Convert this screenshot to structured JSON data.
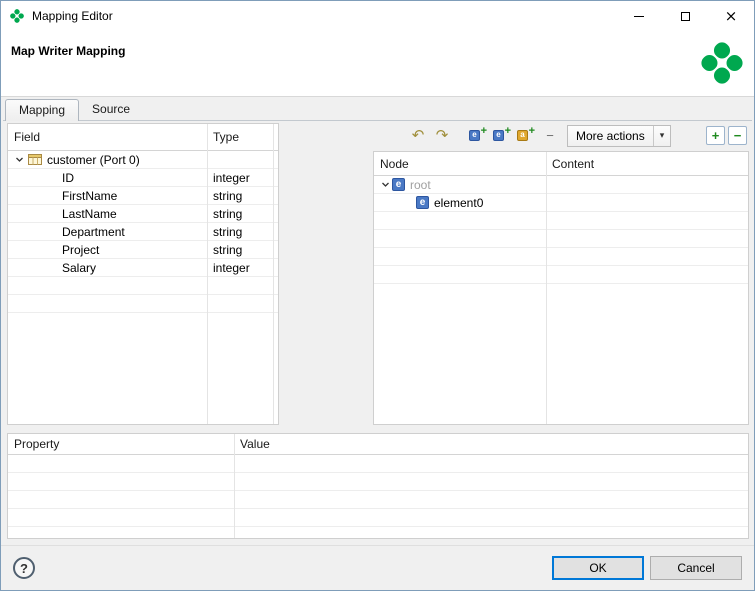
{
  "window": {
    "title": "Mapping Editor"
  },
  "header": {
    "title": "Map Writer Mapping"
  },
  "tabs": {
    "mapping": "Mapping",
    "source": "Source"
  },
  "field_table": {
    "col_field": "Field",
    "col_type": "Type",
    "root_label": "customer (Port 0)",
    "rows": [
      {
        "field": "ID",
        "type": "integer"
      },
      {
        "field": "FirstName",
        "type": "string"
      },
      {
        "field": "LastName",
        "type": "string"
      },
      {
        "field": "Department",
        "type": "string"
      },
      {
        "field": "Project",
        "type": "string"
      },
      {
        "field": "Salary",
        "type": "integer"
      }
    ]
  },
  "toolbar": {
    "more_actions": "More actions"
  },
  "node_table": {
    "col_node": "Node",
    "col_content": "Content",
    "root_label": "root",
    "child_label": "element0"
  },
  "property_table": {
    "col_property": "Property",
    "col_value": "Value"
  },
  "footer": {
    "ok": "OK",
    "cancel": "Cancel"
  },
  "icons": {
    "help": "?",
    "undo_arrow": "↶",
    "redo_arrow": "↷",
    "dropdown_arrow": "▾",
    "plus": "+",
    "minus": "−",
    "dash": "−",
    "element_letter": "e",
    "attribute_letter": "a"
  },
  "colors": {
    "accent": "#0078d7",
    "clover_green": "#00a84f"
  }
}
